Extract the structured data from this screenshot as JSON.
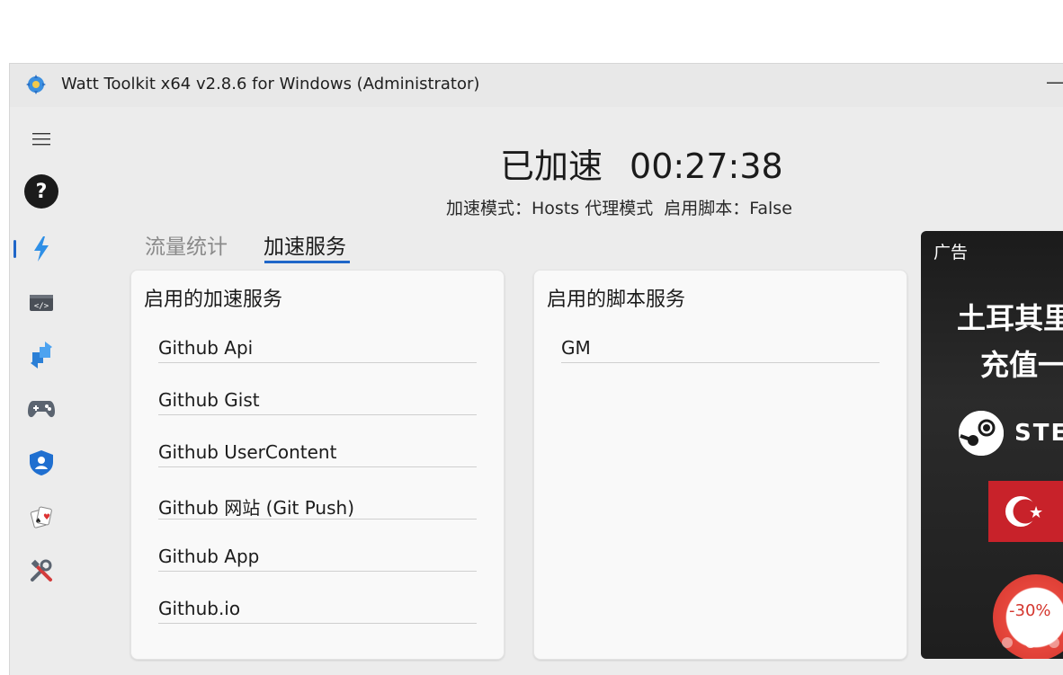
{
  "window": {
    "title": "Watt Toolkit x64 v2.8.6 for Windows (Administrator)",
    "minimize_glyph": "—"
  },
  "sidebar": {
    "items": [
      {
        "name": "menu",
        "icon": "hamburger-icon"
      },
      {
        "name": "help",
        "icon": "question-icon"
      },
      {
        "name": "accelerate",
        "icon": "lightning-icon",
        "active": true
      },
      {
        "name": "script",
        "icon": "code-icon"
      },
      {
        "name": "account",
        "icon": "arrows-icon"
      },
      {
        "name": "game",
        "icon": "gamepad-icon"
      },
      {
        "name": "security",
        "icon": "shield-icon"
      },
      {
        "name": "trading-card",
        "icon": "cards-icon"
      },
      {
        "name": "tools",
        "icon": "tools-icon"
      }
    ],
    "accent_color": "#1f66c8"
  },
  "status": {
    "title": "已加速",
    "timer": "00:27:38",
    "mode_text": "加速模式：Hosts 代理模式",
    "script_text": "启用脚本：False"
  },
  "tabs": {
    "traffic": "流量统计",
    "accel_service": "加速服务",
    "active": "accel_service"
  },
  "left_card": {
    "title": "启用的加速服务",
    "items": [
      "Github Api",
      "Github Gist",
      "Github UserContent",
      "Github 网站 (Git Push)",
      "Github App",
      "Github.io"
    ]
  },
  "right_card": {
    "title": "启用的脚本服务",
    "items": [
      "GM"
    ]
  },
  "ad": {
    "tag": "广告",
    "line1": "土耳其里",
    "line2": "充值一",
    "brand": "STEAM",
    "discount": "-30%"
  }
}
